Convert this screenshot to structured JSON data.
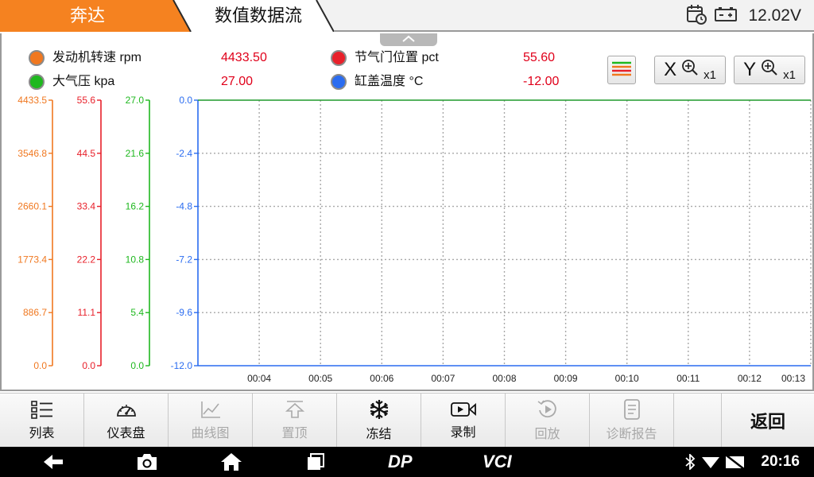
{
  "header": {
    "brand": "奔达",
    "screen_title": "数值数据流",
    "battery_voltage": "12.02V"
  },
  "legend": [
    {
      "name": "发动机转速  rpm",
      "value": "4433.50",
      "color": "#f07820"
    },
    {
      "name": "大气压  kpa",
      "value": "27.00",
      "color": "#1fb81f"
    },
    {
      "name": "节气门位置  pct",
      "value": "55.60",
      "color": "#e8202a"
    },
    {
      "name": "缸盖温度  °C",
      "value": "-12.00",
      "color": "#2a6cf0"
    }
  ],
  "zoom": {
    "x_label": "X",
    "x_multiplier": "x1",
    "y_label": "Y",
    "y_multiplier": "x1"
  },
  "chart_data": {
    "type": "line",
    "x_ticks": [
      "00:04",
      "00:05",
      "00:06",
      "00:07",
      "00:08",
      "00:09",
      "00:10",
      "00:11",
      "00:12",
      "00:13"
    ],
    "axes": [
      {
        "color": "#f07820",
        "ticks": [
          "4433.5",
          "3546.8",
          "2660.1",
          "1773.4",
          "886.7",
          "0.0"
        ]
      },
      {
        "color": "#e8202a",
        "ticks": [
          "55.6",
          "44.5",
          "33.4",
          "22.2",
          "11.1",
          "0.0"
        ]
      },
      {
        "color": "#1fb81f",
        "ticks": [
          "27.0",
          "21.6",
          "16.2",
          "10.8",
          "5.4",
          "0.0"
        ]
      },
      {
        "color": "#2a6cf0",
        "ticks": [
          "0.0",
          "-2.4",
          "-4.8",
          "-7.2",
          "-9.6",
          "-12.0"
        ]
      }
    ],
    "grid": true
  },
  "toolbar": [
    {
      "label": "列表",
      "icon": "list-icon",
      "enabled": true
    },
    {
      "label": "仪表盘",
      "icon": "gauge-icon",
      "enabled": true
    },
    {
      "label": "曲线图",
      "icon": "line-chart-icon",
      "enabled": false
    },
    {
      "label": "置顶",
      "icon": "pin-top-icon",
      "enabled": false
    },
    {
      "label": "冻结",
      "icon": "snowflake-icon",
      "enabled": true
    },
    {
      "label": "录制",
      "icon": "record-icon",
      "enabled": true
    },
    {
      "label": "回放",
      "icon": "playback-icon",
      "enabled": false
    },
    {
      "label": "诊断报告",
      "icon": "report-icon",
      "enabled": false
    }
  ],
  "back_label": "返回",
  "system_bar": {
    "logo_dp": "DP",
    "logo_vci": "VCI",
    "time": "20:16"
  }
}
